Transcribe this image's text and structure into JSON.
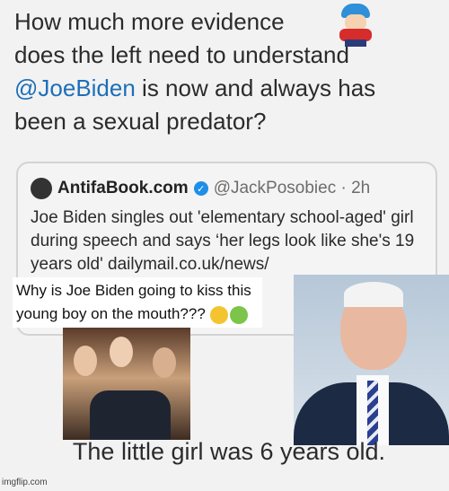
{
  "tweet": {
    "line1": "How much more evidence",
    "line2": "does the left need to understand",
    "mention": "@JoeBiden",
    "line3_rest": " is now and always has",
    "line4": "been a sexual predator?"
  },
  "embedded_tweet": {
    "account_name": "AntifaBook.com",
    "handle_time": "@JackPosobiec · 2h",
    "body": "Joe Biden singles out 'elementary school-aged' girl during speech and says ‘her legs look like she's 19 years old' dailymail.co.uk/news/"
  },
  "overlay": {
    "caption": "Why is Joe Biden going to kiss this young boy on the mouth???"
  },
  "footer": {
    "text": "The little girl was 6 years old."
  },
  "watermark": "imgflip.com",
  "colors": {
    "mention": "#1d6fb8",
    "verified": "#1d8fe8"
  }
}
